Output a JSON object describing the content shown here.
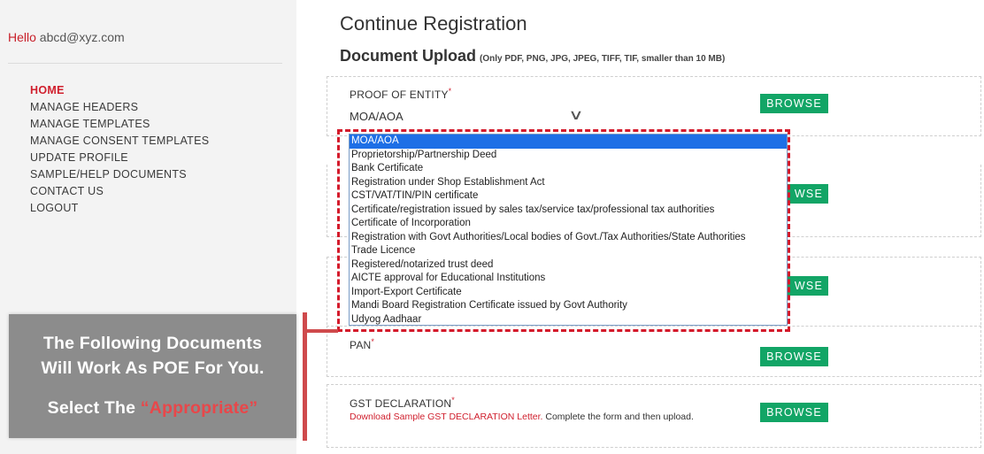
{
  "sidebar": {
    "hello": "Hello",
    "email": "abcd@xyz.com",
    "nav": [
      {
        "label": "HOME",
        "active": true
      },
      {
        "label": "MANAGE HEADERS"
      },
      {
        "label": "MANAGE TEMPLATES"
      },
      {
        "label": "MANAGE CONSENT TEMPLATES"
      },
      {
        "label": "UPDATE PROFILE"
      },
      {
        "label": "SAMPLE/HELP DOCUMENTS"
      },
      {
        "label": "CONTACT US"
      },
      {
        "label": "LOGOUT"
      }
    ]
  },
  "main": {
    "title": "Continue Registration",
    "section": "Document Upload",
    "section_note": "(Only PDF, PNG, JPG, JPEG, TIFF, TIF, smaller than 10 MB)",
    "poe": {
      "label": "PROOF OF ENTITY",
      "required": "*",
      "selected": "MOA/AOA",
      "browse": "BROWSE"
    },
    "partial_browse": "WSE",
    "pan": {
      "label": "PAN",
      "required": "*",
      "browse": "BROWSE"
    },
    "gst": {
      "label": "GST DECLARATION",
      "required": "*",
      "link": "Download Sample GST DECLARATION Letter.",
      "text": " Complete the form and then upload.",
      "browse": "BROWSE"
    }
  },
  "dropdown_options": [
    "MOA/AOA",
    "Proprietorship/Partnership Deed",
    "Bank Certificate",
    "Registration under Shop Establishment Act",
    "CST/VAT/TIN/PIN certificate",
    "Certificate/registration issued by sales tax/service tax/professional tax authorities",
    "Certificate of Incorporation",
    "Registration with Govt Authorities/Local bodies of Govt./Tax Authorities/State Authorities",
    "Trade Licence",
    "Registered/notarized trust deed",
    "AICTE approval for Educational Institutions",
    "Import-Export Certificate",
    "Mandi Board Registration Certificate issued by Govt Authority",
    "Udyog Aadhaar"
  ],
  "callout": {
    "line1": "The Following Documents",
    "line2": "Will Work As POE For You.",
    "line3_prefix": "Select The ",
    "line3_accent": "“Appropriate”"
  },
  "colors": {
    "accent_red": "#d0202e",
    "browse_green": "#12a566",
    "selected_blue": "#1e6fe6",
    "callout_grey": "#8c8c8c"
  }
}
